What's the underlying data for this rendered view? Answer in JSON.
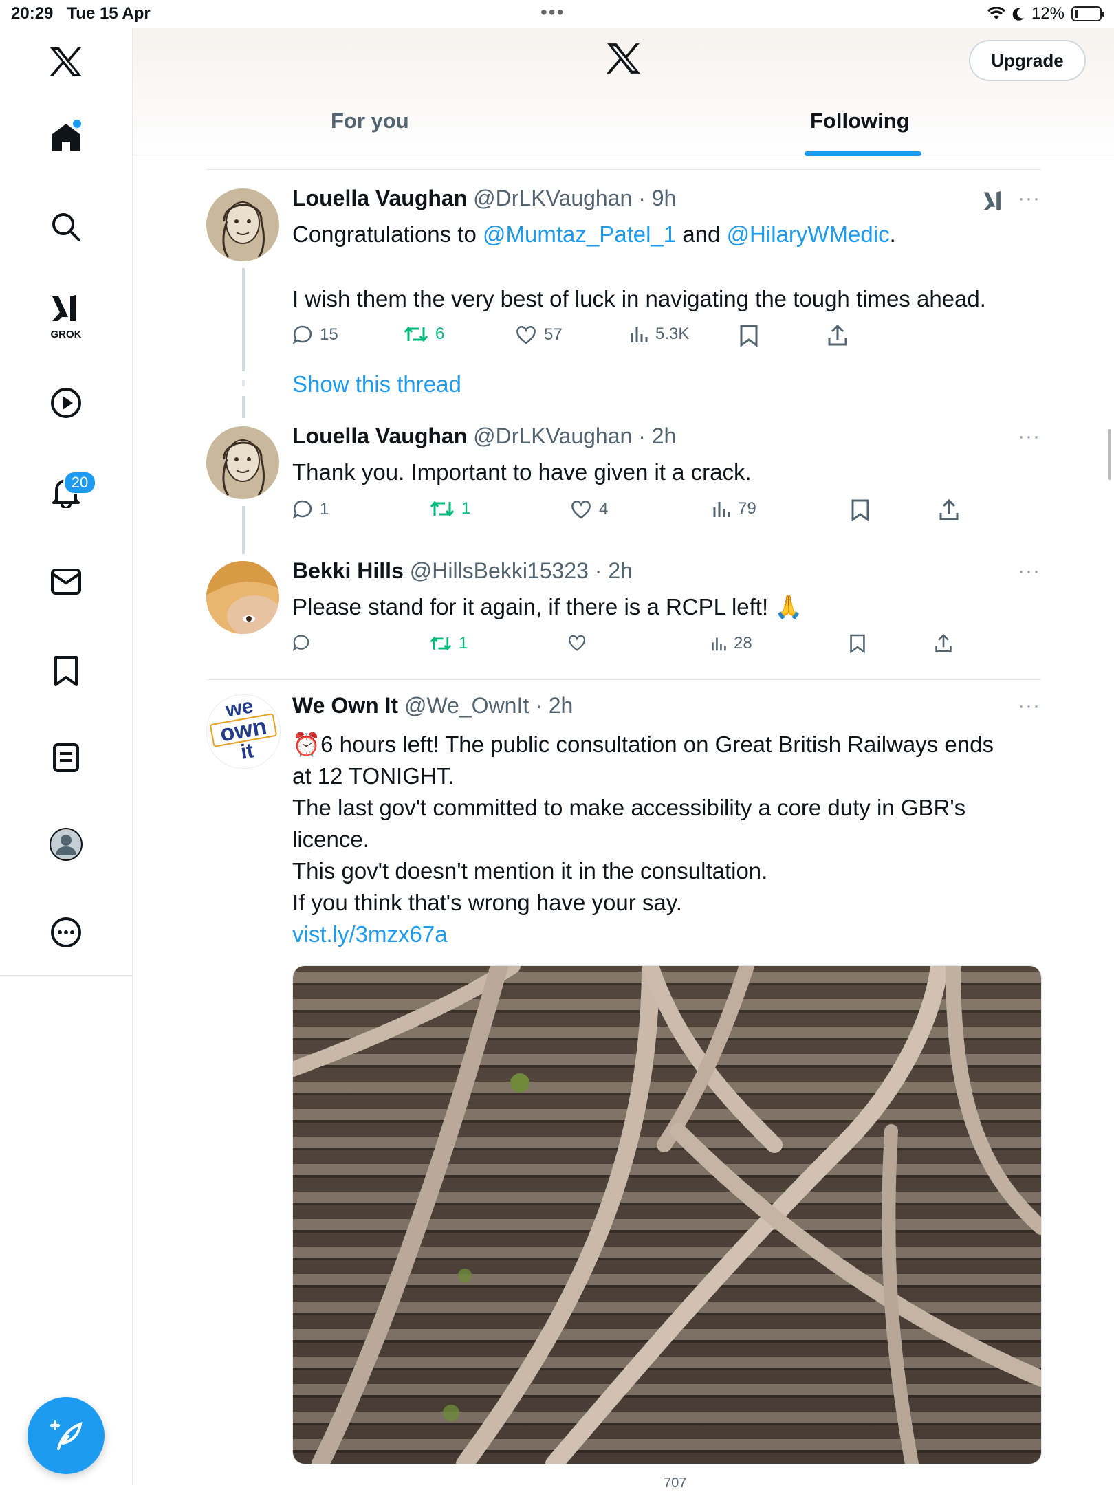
{
  "status": {
    "time": "20:29",
    "date": "Tue 15 Apr",
    "battery": "12%"
  },
  "sidebar": {
    "items": [
      {
        "name": "home",
        "label": "Home"
      },
      {
        "name": "search",
        "label": "Search"
      },
      {
        "name": "grok",
        "label": "GROK"
      },
      {
        "name": "video",
        "label": "Video"
      },
      {
        "name": "notifications",
        "label": "Notifications"
      },
      {
        "name": "messages",
        "label": "Messages"
      },
      {
        "name": "bookmarks",
        "label": "Bookmarks"
      },
      {
        "name": "lists",
        "label": "Lists"
      },
      {
        "name": "profile",
        "label": "Profile"
      },
      {
        "name": "more",
        "label": "More"
      }
    ],
    "grok_label": "GROK",
    "notification_count": "20"
  },
  "header": {
    "upgrade_label": "Upgrade",
    "tabs": [
      {
        "label": "For you"
      },
      {
        "label": "Following"
      }
    ],
    "active_tab": "Following"
  },
  "posts": [
    {
      "name": "Louella Vaughan",
      "handle": "@DrLKVaughan",
      "time": "9h",
      "text_prefix": "Congratulations to ",
      "mention1": "@Mumtaz_Patel_1",
      "text_mid": " and ",
      "mention2": "@HilaryWMedic",
      "text_end": ".",
      "line2": "I wish them the very best of luck in navigating the tough times ahead.",
      "replies": "15",
      "reposts": "6",
      "likes": "57",
      "views": "5.3K",
      "show_thread": "Show this thread"
    },
    {
      "name": "Louella Vaughan",
      "handle": "@DrLKVaughan",
      "time": "2h",
      "text": "Thank you. Important to have given it a crack.",
      "replies": "1",
      "reposts": "1",
      "likes": "4",
      "views": "79"
    },
    {
      "name": "Bekki Hills",
      "handle": "@HillsBekki15323",
      "time": "2h",
      "text": "Please stand for it again, if there is a RCPL left! 🙏",
      "replies": "",
      "reposts": "1",
      "likes": "",
      "views": "28"
    },
    {
      "name": "We Own It",
      "handle": "@We_OwnIt",
      "time": "2h",
      "lines": [
        "⏰6 hours left! The public consultation on Great British Railways ends",
        "at 12 TONIGHT.",
        "The last gov't committed to make accessibility a core duty in GBR's",
        "licence.",
        "This gov't doesn't mention it in the consultation.",
        "If you think that's wrong have your say."
      ],
      "link": "vist.ly/3mzx67a",
      "avatar_text": [
        "we",
        "own",
        "it"
      ],
      "partial_views": "707"
    }
  ],
  "colors": {
    "accent": "#1d9bf0",
    "repost": "#00ba7c",
    "muted": "#536471"
  }
}
